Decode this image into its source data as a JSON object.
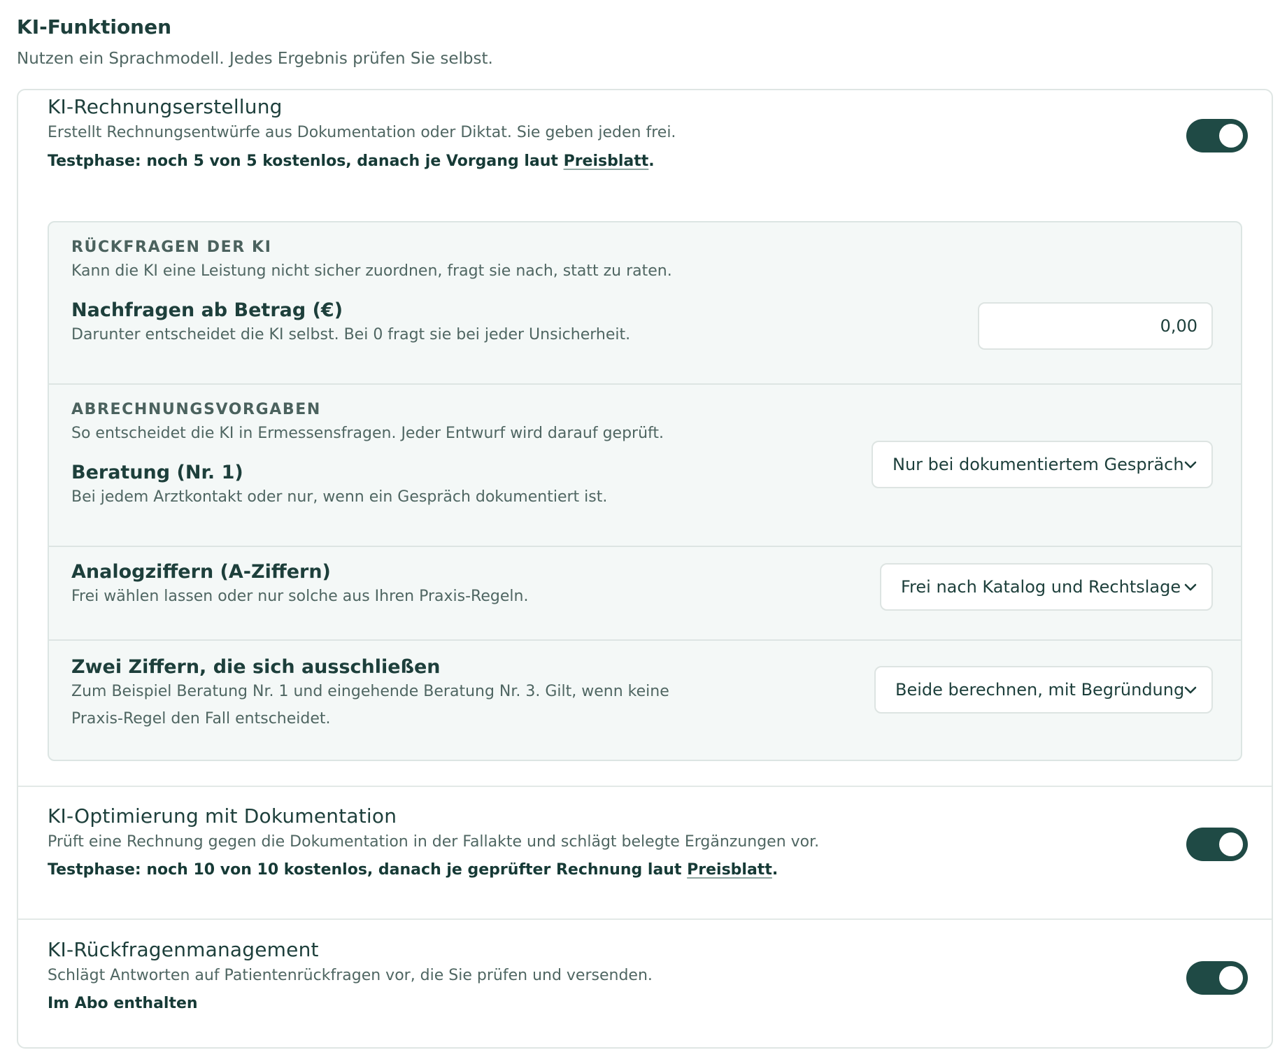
{
  "header": {
    "title": "KI-Funktionen",
    "subtitle": "Nutzen ein Sprachmodell. Jedes Ergebnis prüfen Sie selbst."
  },
  "invoice": {
    "title": "KI-Rechnungserstellung",
    "description": "Erstellt Rechnungsentwürfe aus Dokumentation oder Diktat. Sie geben jeden frei.",
    "note_prefix": "Testphase: noch 5 von 5 kostenlos, danach je Vorgang laut ",
    "note_link": "Preisblatt",
    "note_suffix": ".",
    "enabled": true
  },
  "queries": {
    "label": "RÜCKFRAGEN DER KI",
    "description": "Kann die KI eine Leistung nicht sicher zuordnen, fragt sie nach, statt zu raten.",
    "threshold": {
      "title": "Nachfragen ab Betrag (€)",
      "description": "Darunter entscheidet die KI selbst. Bei 0 fragt sie bei jeder Unsicherheit.",
      "value": "0,00"
    }
  },
  "billing_rules": {
    "label": "ABRECHNUNGSVORGABEN",
    "description": "So entscheidet die KI in Ermessensfragen. Jeder Entwurf wird darauf geprüft.",
    "consultation": {
      "title": "Beratung (Nr. 1)",
      "description": "Bei jedem Arztkontakt oder nur, wenn ein Gespräch dokumentiert ist.",
      "selected": "Nur bei dokumentiertem Gespräch"
    },
    "analog": {
      "title": "Analogziffern (A-Ziffern)",
      "description": "Frei wählen lassen oder nur solche aus Ihren Praxis-Regeln.",
      "selected": "Frei nach Katalog und Rechtslage"
    },
    "exclusive": {
      "title": "Zwei Ziffern, die sich ausschließen",
      "description_line1": "Zum Beispiel Beratung Nr. 1 und eingehende Beratung Nr. 3. Gilt, wenn keine",
      "description_line2": "Praxis-Regel den Fall entscheidet.",
      "selected": "Beide berechnen, mit Begründung"
    }
  },
  "optimization": {
    "title": "KI-Optimierung mit Dokumentation",
    "description": "Prüft eine Rechnung gegen die Dokumentation in der Fallakte und schlägt belegte Ergänzungen vor.",
    "note_prefix": "Testphase: noch 10 von 10 kostenlos, danach je geprüfter Rechnung laut ",
    "note_link": "Preisblatt",
    "note_suffix": ".",
    "enabled": true
  },
  "query_management": {
    "title": "KI-Rückfragenmanagement",
    "description": "Schlägt Antworten auf Patientenrückfragen vor, die Sie prüfen und versenden.",
    "note": "Im Abo enthalten",
    "enabled": true
  },
  "colors": {
    "toggle_on": "#1f4a45",
    "panel_bg": "#f4f8f7",
    "text_primary": "#1d3f3b",
    "text_secondary": "#4f6662"
  },
  "icons": {
    "select_chevron": "chevron-down-icon"
  }
}
